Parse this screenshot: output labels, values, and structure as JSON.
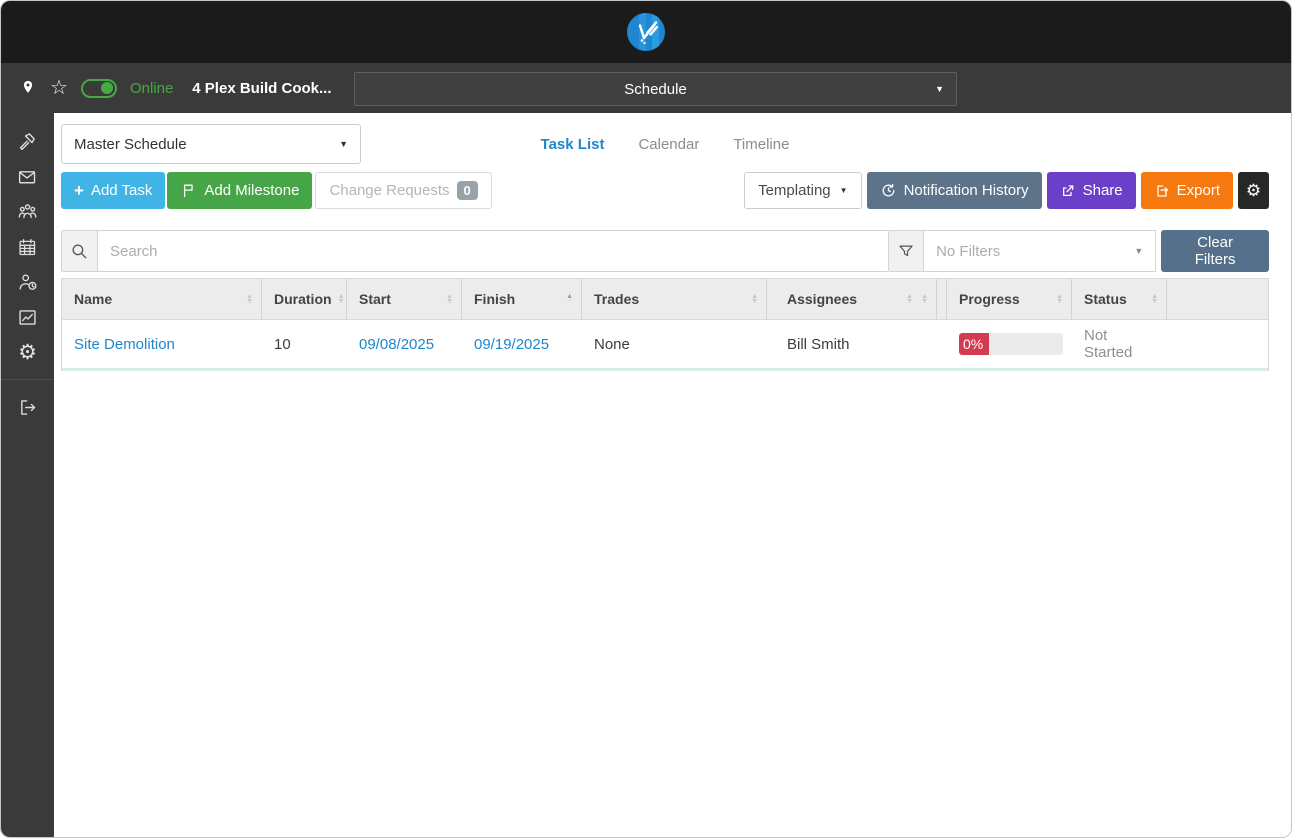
{
  "projectbar": {
    "online": "Online",
    "project": "4 Plex Build Cook...",
    "page": "Schedule"
  },
  "sidebar": {
    "items": [
      {
        "icon": "hammer-icon"
      },
      {
        "icon": "mail-icon"
      },
      {
        "icon": "team-icon"
      },
      {
        "icon": "calendar-icon"
      },
      {
        "icon": "user-clock-icon"
      },
      {
        "icon": "chart-icon"
      },
      {
        "icon": "gear-icon"
      },
      {
        "icon": "logout-icon"
      }
    ]
  },
  "viewbar": {
    "schedule_select": "Master Schedule",
    "tabs": [
      {
        "label": "Task List",
        "active": true
      },
      {
        "label": "Calendar",
        "active": false
      },
      {
        "label": "Timeline",
        "active": false
      }
    ]
  },
  "actions": {
    "add_task": "Add Task",
    "add_milestone": "Add Milestone",
    "change_requests": "Change Requests",
    "change_requests_count": "0",
    "templating": "Templating",
    "notification_history": "Notification History",
    "share": "Share",
    "export": "Export"
  },
  "filterbar": {
    "search_placeholder": "Search",
    "search_value": "",
    "filter_value": "No Filters",
    "clear_filters": "Clear Filters"
  },
  "table": {
    "columns": [
      {
        "label": "Name"
      },
      {
        "label": "Duration"
      },
      {
        "label": "Start"
      },
      {
        "label": "Finish",
        "sort": "asc"
      },
      {
        "label": "Trades"
      },
      {
        "label": "Assignees"
      },
      {
        "label": "Progress"
      },
      {
        "label": "Status"
      }
    ],
    "rows": [
      {
        "name": "Site Demolition",
        "duration": "10",
        "start": "09/08/2025",
        "finish": "09/19/2025",
        "trades": "None",
        "assignees": "Bill Smith",
        "progress_label": "0%",
        "progress_pct": 0,
        "status": "Not Started"
      }
    ]
  },
  "icons": {
    "plus": "+",
    "caret_down": "▼",
    "sort_up": "▲",
    "sort_down": "▼",
    "gear": "⚙",
    "star": "☆"
  },
  "colors": {
    "add_task_blue": "#3fb4e5",
    "milestone_green": "#46a546",
    "slate_button": "#5d7389",
    "share_purple": "#6c3fc9",
    "export_orange": "#f5790e",
    "progress_red": "#d23b50",
    "online_green": "#46aa42",
    "link_blue": "#1d87cc",
    "row_accent_teal": "#d7eee8"
  }
}
